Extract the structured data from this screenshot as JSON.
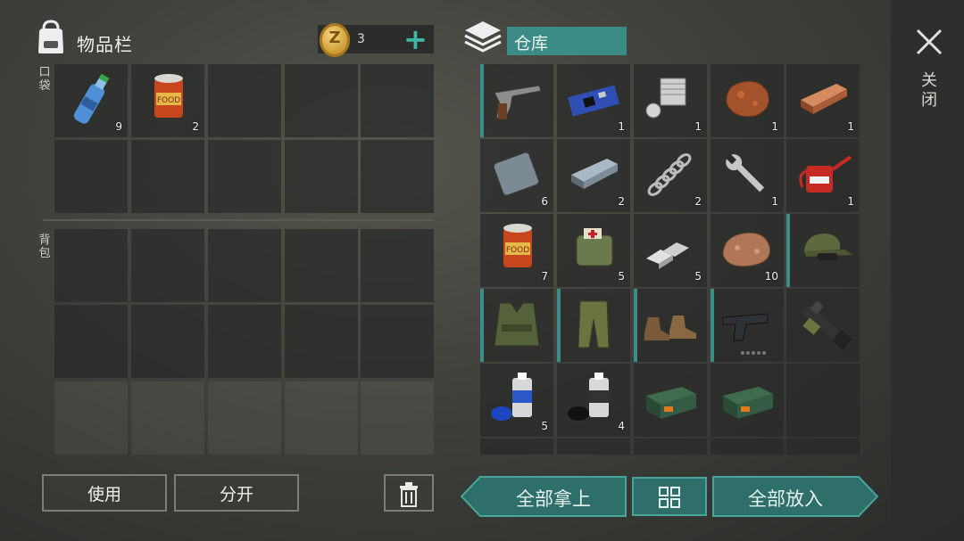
{
  "inventory": {
    "title": "物品栏",
    "coin_symbol": "Z",
    "coin_count": "3",
    "plus_label": "+",
    "pocket_label": "口袋",
    "backpack_label": "背包",
    "pocket_slots": [
      {
        "item": "water-bottle",
        "count": "9"
      },
      {
        "item": "canned-food",
        "count": "2"
      },
      {},
      {},
      {},
      {},
      {},
      {},
      {},
      {}
    ],
    "use_label": "使用",
    "split_label": "分开"
  },
  "storage": {
    "title": "仓库",
    "slots": [
      {
        "item": "revolver",
        "count": "",
        "bar": true
      },
      {
        "item": "circuit-board",
        "count": "1"
      },
      {
        "item": "engine-cylinder",
        "count": "1"
      },
      {
        "item": "copper-ore",
        "count": "1"
      },
      {
        "item": "copper-ingot",
        "count": "1"
      },
      {
        "item": "metal-plate",
        "count": "6"
      },
      {
        "item": "iron-ingot",
        "count": "2"
      },
      {
        "item": "spring",
        "count": "2"
      },
      {
        "item": "wrench",
        "count": "1"
      },
      {
        "item": "oil-can",
        "count": "1"
      },
      {
        "item": "canned-food",
        "count": "7"
      },
      {
        "item": "first-aid-bag",
        "count": "5"
      },
      {
        "item": "silver-ingots",
        "count": "5"
      },
      {
        "item": "stone-ore",
        "count": "10"
      },
      {
        "item": "military-cap",
        "count": "",
        "bar": true
      },
      {
        "item": "tactical-vest",
        "count": "",
        "bar": true
      },
      {
        "item": "camo-pants",
        "count": "",
        "bar": true
      },
      {
        "item": "leather-boots",
        "count": "",
        "bar": true
      },
      {
        "item": "pistol",
        "count": "",
        "bar": true
      },
      {
        "item": "machine-gun",
        "count": ""
      },
      {
        "item": "blue-spray-paint",
        "count": "5"
      },
      {
        "item": "black-spray-paint",
        "count": "4"
      },
      {
        "item": "green-crate",
        "count": ""
      },
      {
        "item": "green-crate",
        "count": ""
      },
      {}
    ],
    "take_all_label": "全部拿上",
    "put_all_label": "全部放入"
  },
  "close_label": "关闭",
  "colors": {
    "accent": "#2f6f6a",
    "accent_border": "#48a59b"
  }
}
